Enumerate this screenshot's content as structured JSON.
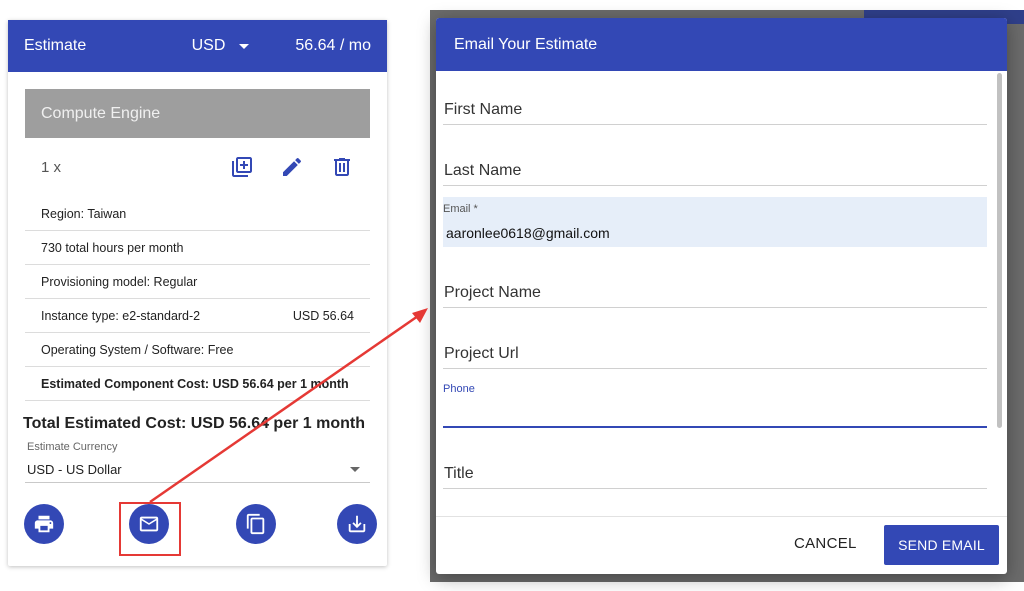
{
  "estimate": {
    "header": {
      "title": "Estimate",
      "currency": "USD",
      "cost": "56.64 / mo"
    },
    "section_title": "Compute Engine",
    "quantity": "1 x",
    "lines": [
      {
        "label": "Region: Taiwan",
        "value": ""
      },
      {
        "label": "730 total hours per month",
        "value": ""
      },
      {
        "label": "Provisioning model: Regular",
        "value": ""
      },
      {
        "label": "Instance type: e2-standard-2",
        "value": "USD 56.64"
      },
      {
        "label": "Operating System / Software: Free",
        "value": ""
      },
      {
        "label": "Estimated Component Cost: USD 56.64 per 1 month",
        "value": ""
      }
    ],
    "total": "Total Estimated Cost: USD 56.64 per 1 month",
    "currency_label": "Estimate Currency",
    "currency_value": "USD - US Dollar"
  },
  "dialog": {
    "title": "Email Your Estimate",
    "fields": {
      "first_name": "First Name",
      "last_name": "Last Name",
      "email_label": "Email *",
      "email_value": "aaronlee0618@gmail.com",
      "project_name": "Project Name",
      "project_url": "Project Url",
      "phone_label": "Phone",
      "title": "Title"
    },
    "cancel": "CANCEL",
    "send": "SEND EMAIL"
  },
  "colors": {
    "primary": "#3348b5",
    "annotation": "#e53935"
  },
  "icons": [
    "add-to-queue-icon",
    "edit-pencil-icon",
    "delete-icon",
    "print-icon",
    "email-icon",
    "copy-icon",
    "download-icon"
  ]
}
